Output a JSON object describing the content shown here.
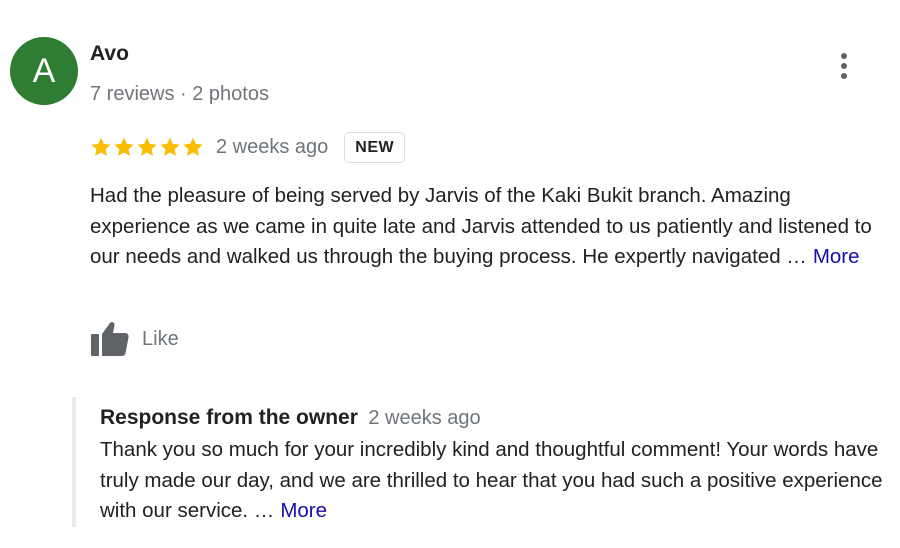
{
  "reviewer": {
    "avatar_letter": "A",
    "avatar_color": "#2e7d32",
    "name": "Avo",
    "meta": "7 reviews · 2 photos"
  },
  "menu": {
    "icon": "more-vert-icon"
  },
  "review": {
    "rating": 5,
    "rating_max": 5,
    "star_color": "#fbbc04",
    "date": "2 weeks ago",
    "badge": "NEW",
    "text": "Had the pleasure of being served by Jarvis of the Kaki Bukit branch. Amazing experience as we came in quite late and Jarvis attended to us patiently and listened to our needs and walked us through the buying process. He expertly navigated …",
    "more_label": "More"
  },
  "like": {
    "icon": "thumbs-up-icon",
    "label": "Like"
  },
  "owner_response": {
    "title": "Response from the owner",
    "date": "2 weeks ago",
    "text": "Thank you so much for your incredibly kind and thoughtful comment! Your words have truly made our day, and we are thrilled to hear that you had such a positive experience with our service. …",
    "more_label": "More"
  },
  "colors": {
    "link": "#1a0dab",
    "secondary_text": "#70757a",
    "primary_text": "#202124"
  }
}
